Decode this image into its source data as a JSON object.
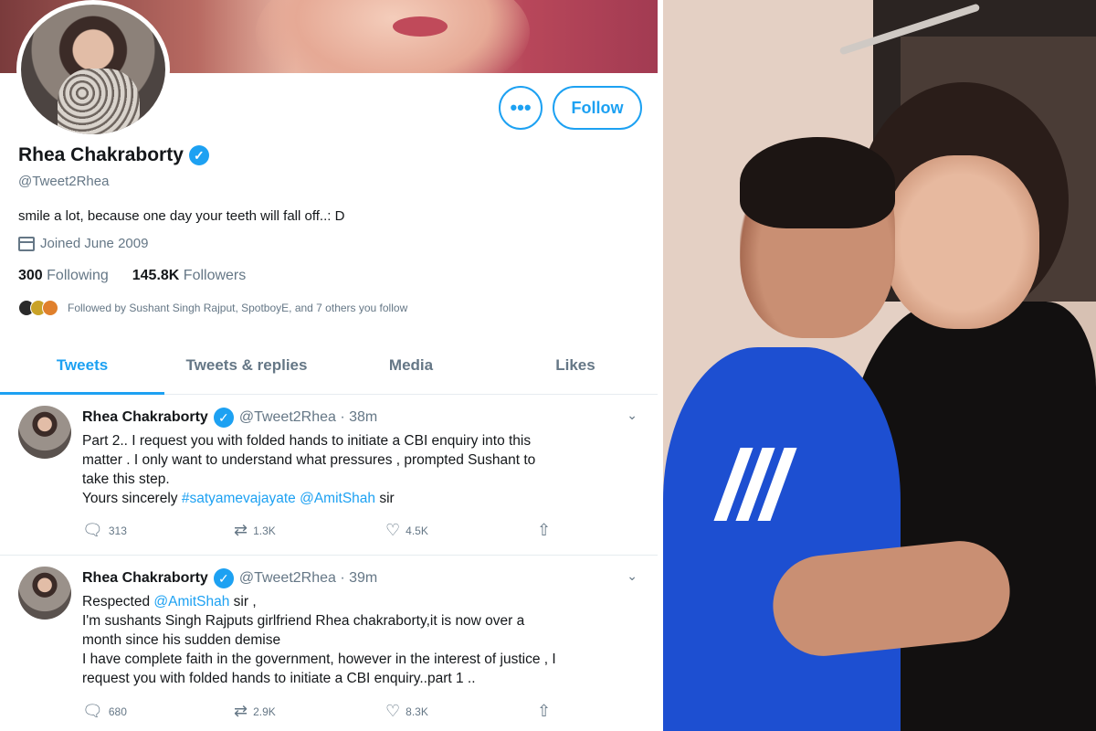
{
  "profile": {
    "name": "Rhea Chakraborty",
    "handle": "@Tweet2Rhea",
    "bio": "smile a lot, because one day your teeth will fall off..: D",
    "joined": "Joined June 2009",
    "following_count": "300",
    "following_label": "Following",
    "followers_count": "145.8K",
    "followers_label": "Followers",
    "followed_by": "Followed by Sushant Singh Rajput, SpotboyE, and 7 others you follow",
    "more_icon": "•••",
    "follow_label": "Follow"
  },
  "tabs": [
    {
      "label": "Tweets"
    },
    {
      "label": "Tweets & replies"
    },
    {
      "label": "Media"
    },
    {
      "label": "Likes"
    }
  ],
  "tweets": [
    {
      "name": "Rhea Chakraborty",
      "meta": "@Tweet2Rhea · 38m",
      "line1": "Part 2.. I request you with folded hands to initiate a CBI enquiry into this",
      "line2": "matter . I only want to understand what pressures , prompted Sushant to",
      "line3": "take this step.",
      "line4_pre": "Yours sincerely ",
      "line4_tag": "#satyamevajayate",
      "line4_mention": "@AmitShah",
      "line4_post": " sir",
      "replies": "313",
      "retweets": "1.3K",
      "likes": "4.5K"
    },
    {
      "name": "Rhea Chakraborty",
      "meta": "@Tweet2Rhea · 39m",
      "line1_pre": "Respected ",
      "line1_mention": "@AmitShah",
      "line1_post": " sir ,",
      "line2": "I'm sushants Singh Rajputs girlfriend Rhea chakraborty,it is now over a",
      "line3": "month since his sudden demise",
      "line4": "I have complete faith in the government, however in the interest of justice , I",
      "line5": "request you with folded hands to initiate a CBI enquiry..part 1 ..",
      "replies": "680",
      "retweets": "2.9K",
      "likes": "8.3K"
    }
  ],
  "icons": {
    "verified": "verified-badge-icon",
    "calendar": "calendar-icon",
    "reply": "reply-icon",
    "retweet": "retweet-icon",
    "like": "heart-icon",
    "share": "share-icon",
    "caret": "chevron-down-icon"
  },
  "colors": {
    "accent": "#1da1f2",
    "muted": "#657786",
    "text": "#14171a"
  }
}
